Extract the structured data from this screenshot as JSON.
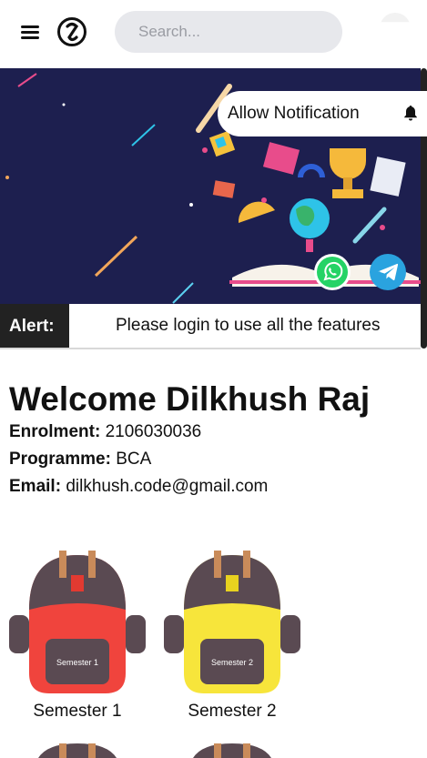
{
  "header": {
    "search_placeholder": "Search..."
  },
  "banner": {
    "allow_notification_label": "Allow Notification"
  },
  "alert": {
    "label": "Alert:",
    "message": "Please login to use all the features"
  },
  "profile": {
    "welcome": "Welcome Dilkhush Raj",
    "enrolment_label": "Enrolment:",
    "enrolment_value": "2106030036",
    "programme_label": "Programme:",
    "programme_value": "BCA",
    "email_label": "Email:",
    "email_value": "dilkhush.code@gmail.com"
  },
  "semesters": [
    {
      "caption": "Semester 1",
      "patch": "Semester 1",
      "color": "#f0443d"
    },
    {
      "caption": "Semester 2",
      "patch": "Semester 2",
      "color": "#f7e53b"
    }
  ],
  "colors": {
    "banner_bg": "#1d1f4f",
    "alert_label_bg": "#222222",
    "whatsapp": "#25d366",
    "telegram": "#2aa3df"
  }
}
